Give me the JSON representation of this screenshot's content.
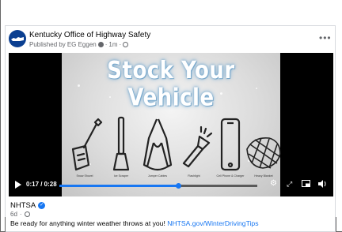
{
  "post": {
    "page_name": "Kentucky Office of Highway Safety",
    "published_prefix": "Published by",
    "publisher": "EG Eggen",
    "time_ago": "1m",
    "more_label": "•••"
  },
  "video": {
    "title": "Stock Your Vehicle",
    "items": [
      {
        "label": "Snow Shovel",
        "icon": "snow-shovel-icon"
      },
      {
        "label": "Ice Scraper",
        "icon": "ice-scraper-icon"
      },
      {
        "label": "Jumper Cables",
        "icon": "jumper-cables-icon"
      },
      {
        "label": "Flashlight",
        "icon": "flashlight-icon"
      },
      {
        "label": "Cell Phone & Charger",
        "icon": "cell-phone-icon"
      },
      {
        "label": "Heavy Blanket",
        "icon": "blanket-icon"
      }
    ],
    "time_display": "0:17 / 0:28",
    "progress_fraction": 0.6,
    "accent_color": "#1877f2"
  },
  "source": {
    "name": "NHTSA",
    "time_ago": "6d",
    "caption_text": "Be ready for anything winter weather throws at you! ",
    "caption_link": "NHTSA.gov/WinterDrivingTips"
  }
}
